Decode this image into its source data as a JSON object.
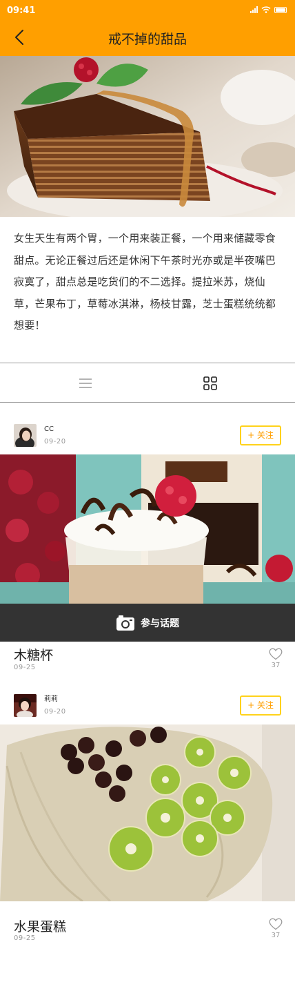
{
  "status_bar": {
    "time": "09:41"
  },
  "nav": {
    "title": "戒不掉的甜品"
  },
  "intro": {
    "text": "女生天生有两个胃，一个用来装正餐，一个用来储藏零食甜点。无论正餐过后还是休闲下午茶时光亦或是半夜嘴巴寂寞了，甜点总是吃货们的不二选择。提拉米苏，烧仙草，芒果布丁，草莓冰淇淋，杨枝甘露，芝士蛋糕统统都想要！"
  },
  "view_toggle": {
    "list_icon": "list-icon",
    "grid_icon": "grid-icon",
    "active": "grid"
  },
  "posts": [
    {
      "author": "CC",
      "author_date": "09-20",
      "follow_label": "+ 关注",
      "title": "木糖杯",
      "date": "09-25",
      "likes": "37"
    },
    {
      "author": "莉莉",
      "author_date": "09-20",
      "follow_label": "+ 关注",
      "title": "水果蛋糕",
      "date": "09-25",
      "likes": "37"
    }
  ],
  "join_bar": {
    "label": "参与话题",
    "icon": "camera-icon"
  },
  "colors": {
    "accent": "#ff9f00",
    "follow_border": "#ffd21a",
    "join_bar": "#333333"
  }
}
